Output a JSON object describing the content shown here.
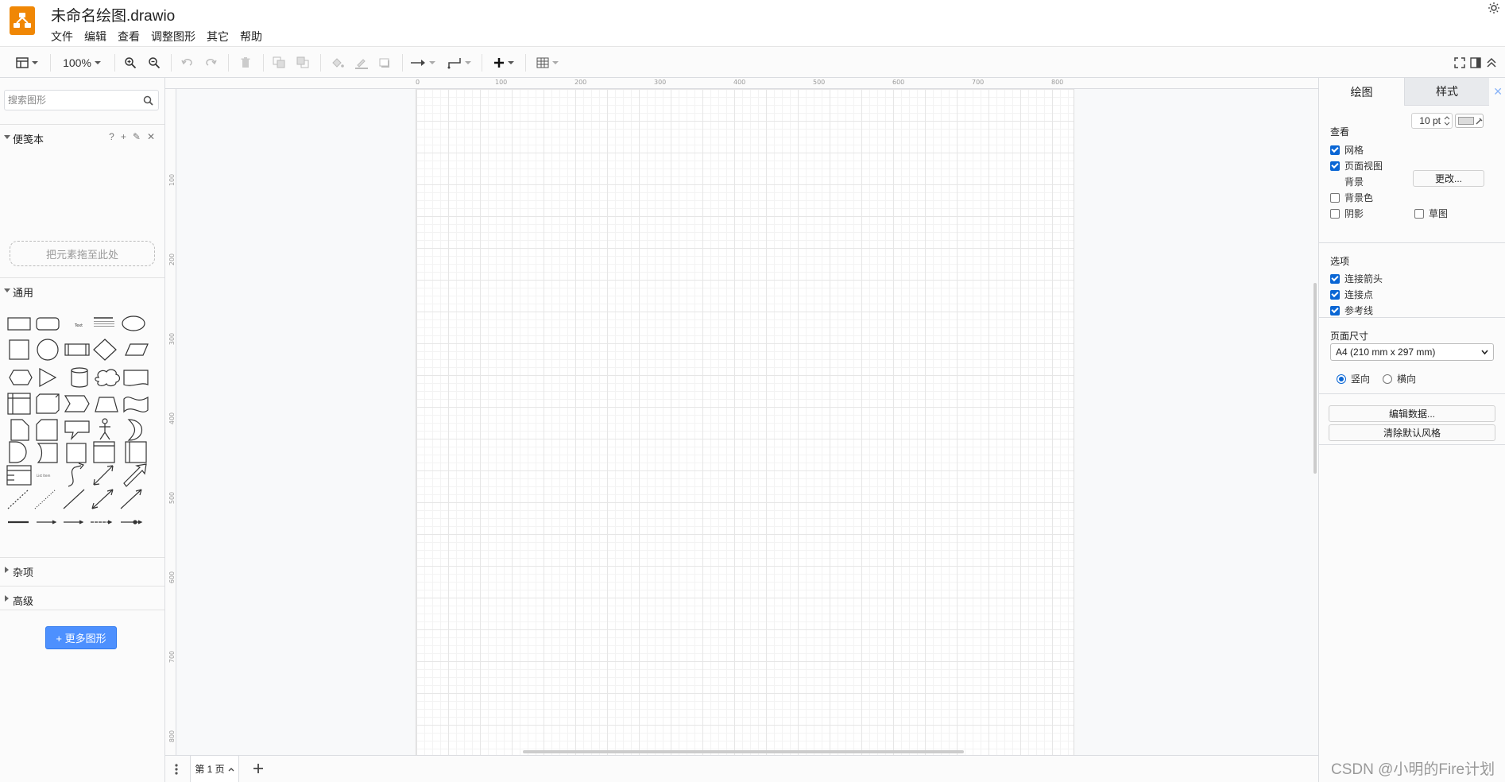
{
  "app": {
    "document_title": "未命名绘图.drawio",
    "menus": [
      "文件",
      "编辑",
      "查看",
      "调整图形",
      "其它",
      "帮助"
    ]
  },
  "toolbar": {
    "zoom": "100%"
  },
  "sidebar": {
    "search_placeholder": "搜索图形",
    "scratchpad_label": "便笺本",
    "scratchpad_tools": [
      "?",
      "+",
      "✎",
      "✕"
    ],
    "dropzone_text": "把元素拖至此处",
    "general_label": "通用",
    "misc_label": "杂项",
    "advanced_label": "高级",
    "more_shapes_label": "+ 更多图形"
  },
  "rulers": {
    "top": [
      "0",
      "100",
      "200",
      "300",
      "400",
      "500",
      "600",
      "700",
      "800"
    ],
    "left": [
      "100",
      "200",
      "300",
      "400",
      "500",
      "600",
      "700",
      "800"
    ]
  },
  "pages": {
    "current_tab": "第 1 页"
  },
  "format_panel": {
    "tab_diagram": "绘图",
    "tab_style": "样式",
    "view_title": "查看",
    "grid_label": "网格",
    "grid_size": "10 pt",
    "page_view_label": "页面视图",
    "background_label": "背景",
    "change_button": "更改...",
    "background_color_label": "背景色",
    "shadow_label": "阴影",
    "sketch_label": "草图",
    "options_title": "选项",
    "connection_arrows_label": "连接箭头",
    "connection_points_label": "连接点",
    "guides_label": "参考线",
    "page_size_title": "页面尺寸",
    "page_size_value": "A4 (210 mm x 297 mm)",
    "portrait_label": "竖向",
    "landscape_label": "横向",
    "edit_data_button": "编辑数据...",
    "clear_style_button": "清除默认风格"
  },
  "checked": {
    "grid": true,
    "page_view": true,
    "background_color": false,
    "shadow": false,
    "sketch": false,
    "connection_arrows": true,
    "connection_points": true,
    "guides": true,
    "portrait": true,
    "landscape": false
  },
  "watermark": "CSDN @小明的Fire计划",
  "colors": {
    "brand": "#f08705",
    "accent": "#4d90fe"
  }
}
